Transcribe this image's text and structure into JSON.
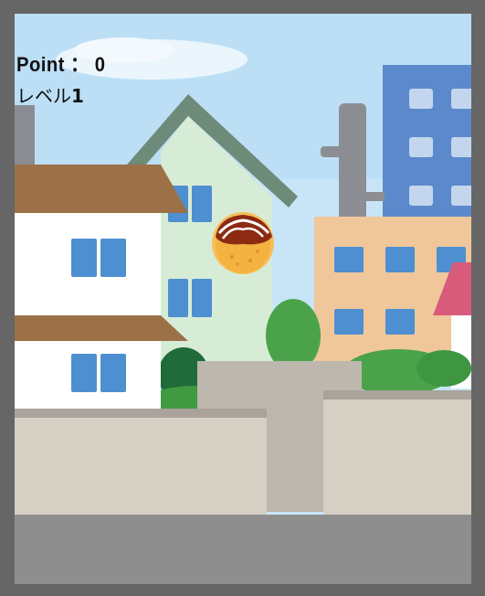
{
  "hud": {
    "point_label": "Point",
    "point_separator": "：",
    "point_value": "0",
    "level_label": "レベル",
    "level_value": "1"
  },
  "scene": {
    "sky_color": "#c9e6f8",
    "target_icon": "takoyaki-icon"
  }
}
